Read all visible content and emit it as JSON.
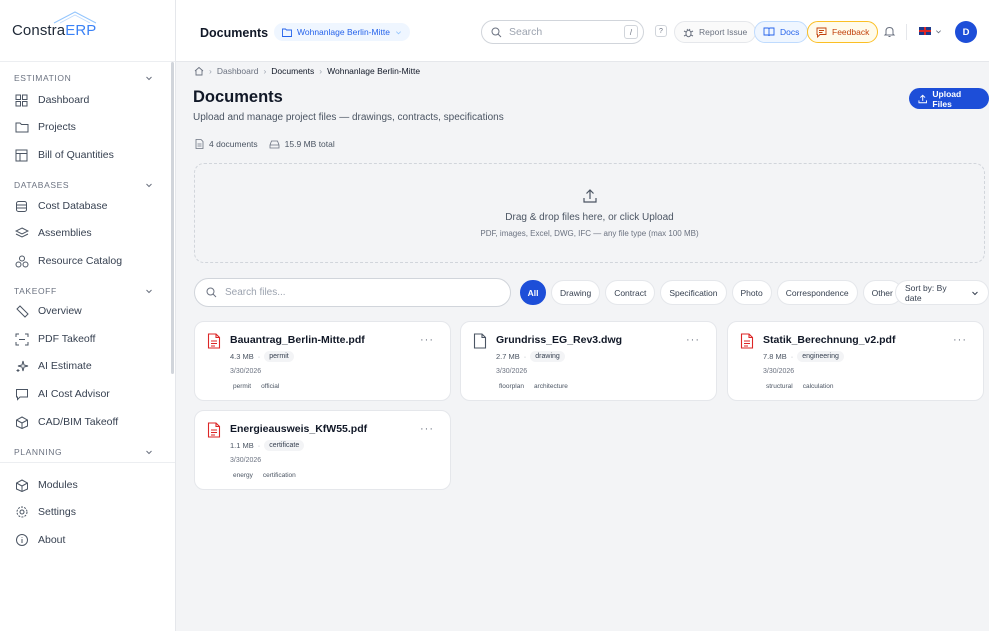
{
  "app": {
    "logo_main": "Constra",
    "logo_accent": "ERP"
  },
  "sidebar": {
    "sections": [
      {
        "title": "ESTIMATION",
        "items": [
          {
            "label": "Dashboard"
          },
          {
            "label": "Projects"
          },
          {
            "label": "Bill of Quantities"
          }
        ]
      },
      {
        "title": "DATABASES",
        "items": [
          {
            "label": "Cost Database"
          },
          {
            "label": "Assemblies"
          },
          {
            "label": "Resource Catalog"
          }
        ]
      },
      {
        "title": "TAKEOFF",
        "items": [
          {
            "label": "Overview"
          },
          {
            "label": "PDF Takeoff"
          },
          {
            "label": "AI Estimate"
          },
          {
            "label": "AI Cost Advisor"
          },
          {
            "label": "CAD/BIM Takeoff"
          }
        ]
      },
      {
        "title": "PLANNING",
        "items": []
      }
    ],
    "bottom_items": [
      {
        "label": "Modules"
      },
      {
        "label": "Settings"
      },
      {
        "label": "About"
      }
    ]
  },
  "header": {
    "title": "Documents",
    "project": "Wohnanlage Berlin-Mitte",
    "search_placeholder": "Search",
    "search_shortcut": "/",
    "help_label": "?",
    "report_label": "Report Issue",
    "docs_label": "Docs",
    "feedback_label": "Feedback",
    "avatar_initial": "D"
  },
  "breadcrumb": {
    "items": [
      "Dashboard",
      "Documents",
      "Wohnanlage Berlin-Mitte"
    ]
  },
  "page": {
    "title": "Documents",
    "subtitle": "Upload and manage project files — drawings, contracts, specifications",
    "upload_label": "Upload Files",
    "doc_count": "4 documents",
    "total_size": "15.9 MB total"
  },
  "dropzone": {
    "main": "Drag & drop files here, or click Upload",
    "sub": "PDF, images, Excel, DWG, IFC — any file type (max 100 MB)"
  },
  "filters": {
    "search_placeholder": "Search files...",
    "chips": [
      "All",
      "Drawing",
      "Contract",
      "Specification",
      "Photo",
      "Correspondence",
      "Other"
    ],
    "active_chip": "All",
    "sort_label": "Sort by: By date"
  },
  "files": [
    {
      "name": "Bauantrag_Berlin-Mitte.pdf",
      "size": "4.3 MB",
      "category": "permit",
      "date": "3/30/2026",
      "tags": [
        "permit",
        "official"
      ],
      "type": "pdf"
    },
    {
      "name": "Grundriss_EG_Rev3.dwg",
      "size": "2.7 MB",
      "category": "drawing",
      "date": "3/30/2026",
      "tags": [
        "floorplan",
        "architecture"
      ],
      "type": "dwg"
    },
    {
      "name": "Statik_Berechnung_v2.pdf",
      "size": "7.8 MB",
      "category": "engineering",
      "date": "3/30/2026",
      "tags": [
        "structural",
        "calculation"
      ],
      "type": "pdf"
    },
    {
      "name": "Energieausweis_KfW55.pdf",
      "size": "1.1 MB",
      "category": "certificate",
      "date": "3/30/2026",
      "tags": [
        "energy",
        "certification"
      ],
      "type": "pdf"
    }
  ],
  "colors": {
    "accent": "#1d4ed8",
    "pdf_icon": "#dc2626",
    "feedback": "#c2410c"
  }
}
